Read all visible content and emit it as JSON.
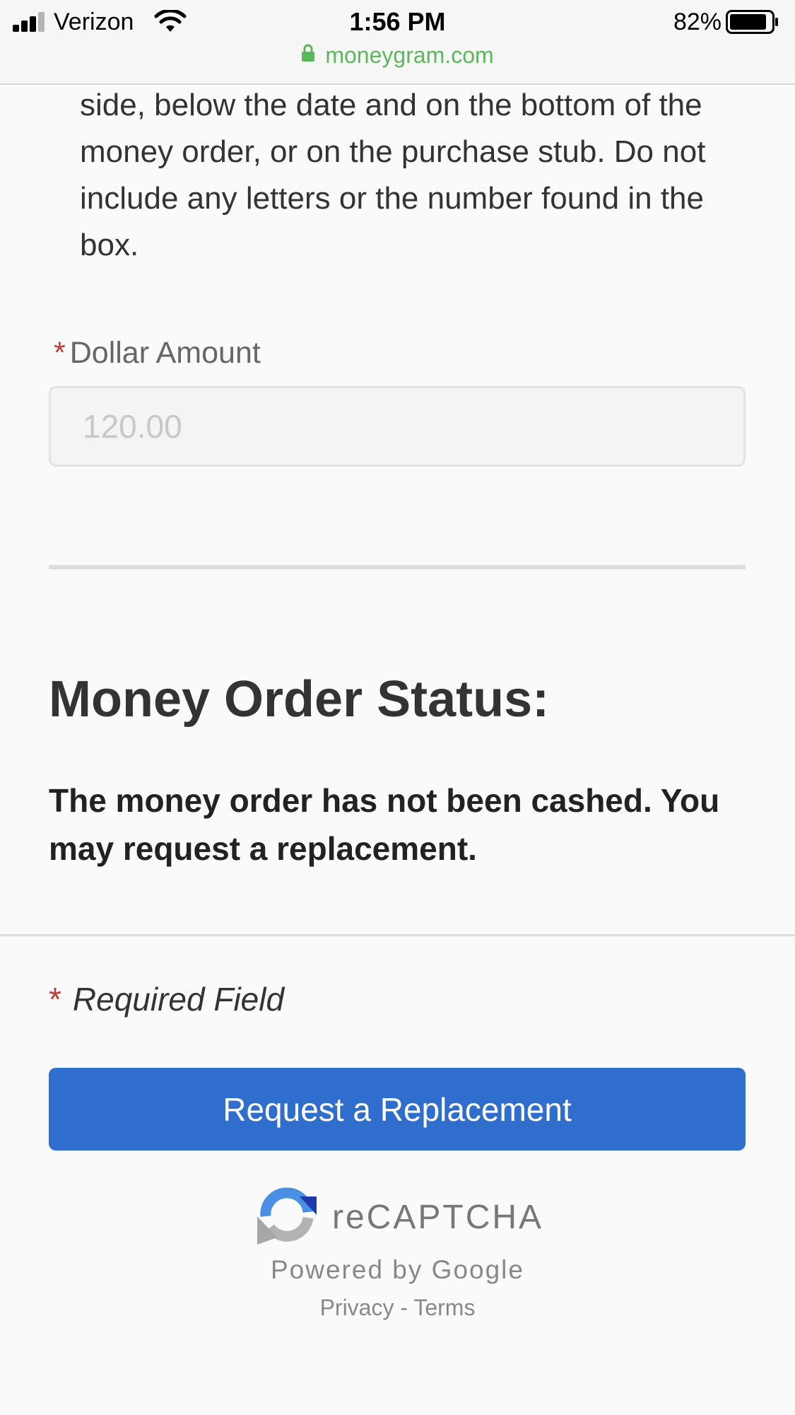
{
  "status_bar": {
    "carrier": "Verizon",
    "time": "1:56 PM",
    "battery_percent": "82%",
    "battery_level": 0.82,
    "signal_bars": 3,
    "signal_bars_total": 4
  },
  "browser": {
    "domain": "moneygram.com",
    "secure_color": "#5cb85c"
  },
  "form": {
    "instruction_text": "side, below the date and on the bottom of the money order, or on the purchase stub. Do not include any letters or the number found in the box.",
    "dollar_amount": {
      "required_marker": "*",
      "label": "Dollar Amount",
      "value": "120.00"
    }
  },
  "status": {
    "heading": "Money Order Status:",
    "message": "The money order has not been cashed. You may request a replacement."
  },
  "footer": {
    "required_marker": "*",
    "required_note": "Required Field",
    "button_label": "Request a Replacement",
    "button_color": "#2f6ecc"
  },
  "recaptcha": {
    "brand": "reCAPTCHA",
    "powered_by": "Powered by Google",
    "privacy_label": "Privacy",
    "separator": "-",
    "terms_label": "Terms",
    "icon": "recaptcha-icon"
  },
  "colors": {
    "accent": "#2f6ecc",
    "required": "#c23934",
    "text": "#333333",
    "background": "#fafafa"
  }
}
